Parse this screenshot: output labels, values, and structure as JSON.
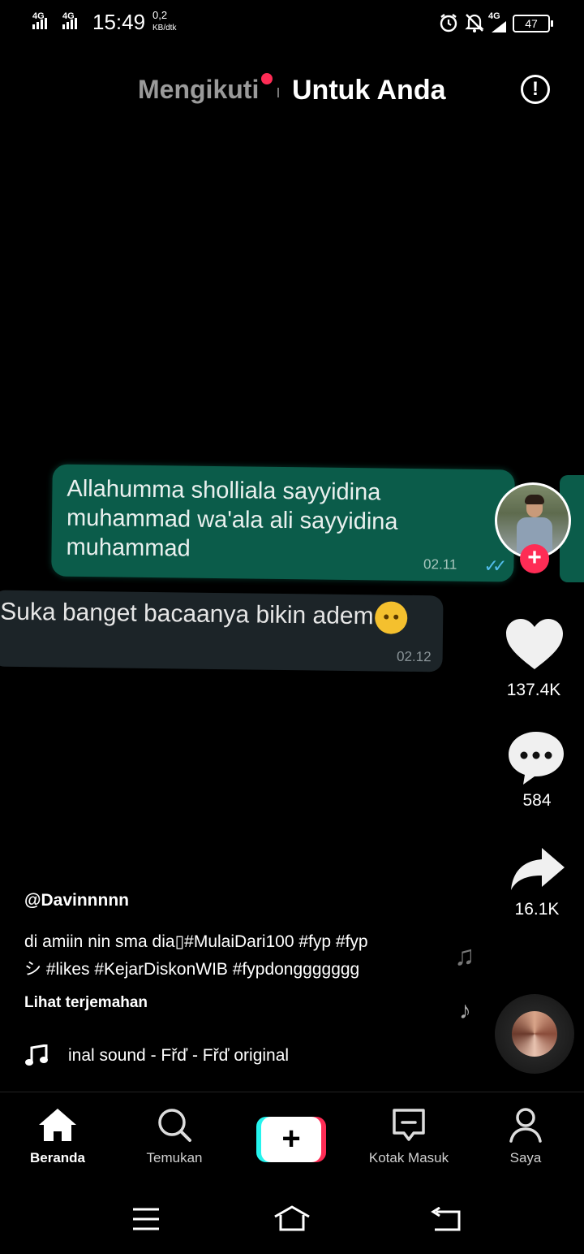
{
  "status_bar": {
    "signal1": "4G",
    "signal2": "4G",
    "time": "15:49",
    "speed_value": "0,2",
    "speed_unit": "KB/dtk",
    "network_right": "4G",
    "battery": "47"
  },
  "header": {
    "tab_following": "Mengikuti",
    "tab_for_you": "Untuk Anda",
    "report_icon": "exclamation-circle-icon"
  },
  "video": {
    "bubble1_text": "Allahumma sholliala sayyidina\nmuhammad wa'ala ali sayyidina\nmuhammad",
    "bubble1_time": "02.11",
    "bubble2_text": "Suka banget bacaanya bikin adem",
    "bubble2_time": "02.12"
  },
  "actions": {
    "likes": "137.4K",
    "comments": "584",
    "shares": "16.1K"
  },
  "post": {
    "username": "@Davinnnnn",
    "caption": "di amiin nin sma dia▯#MulaiDari100 #fyp #fyp\nシ #likes #KejarDiskonWIB #fypdonggggggg",
    "translate": "Lihat terjemahan",
    "sound": "inal sound - Fřď - Fřď     original"
  },
  "nav": {
    "home": "Beranda",
    "discover": "Temukan",
    "inbox": "Kotak Masuk",
    "profile": "Saya"
  },
  "colors": {
    "accent_red": "#fe2c55",
    "accent_cyan": "#25f4ee",
    "bubble_green": "#0b5c4a",
    "bubble_dark": "#1c2428"
  }
}
